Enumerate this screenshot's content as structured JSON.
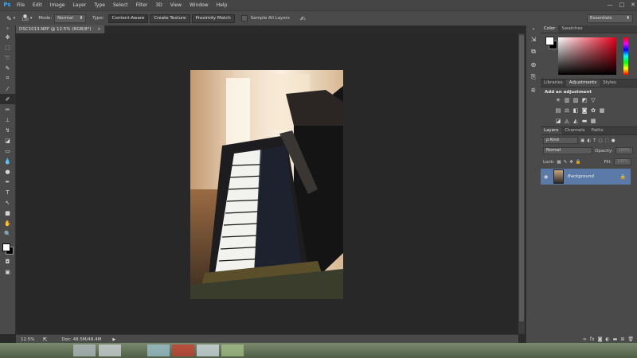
{
  "app": {
    "logo": "Ps"
  },
  "menu": [
    "File",
    "Edit",
    "Image",
    "Layer",
    "Type",
    "Select",
    "Filter",
    "3D",
    "View",
    "Window",
    "Help"
  ],
  "window_controls": {
    "minimize": "—",
    "maximize": "□",
    "close": "✕"
  },
  "options_bar": {
    "brush_size": "120",
    "mode_label": "Mode:",
    "mode_value": "Normal",
    "type_label": "Type:",
    "type_buttons": [
      "Content-Aware",
      "Create Texture",
      "Proximity Match"
    ],
    "sample_all_layers": "Sample All Layers",
    "workspace": "Essentials"
  },
  "document": {
    "tab_title": "DSC1013.NEF @ 12.5% (RGB/8*)",
    "close": "×",
    "zoom": "12.5%",
    "doc_size": "Doc: 48.5M/48.4M"
  },
  "panels": {
    "color_tabs": [
      "Color",
      "Swatches"
    ],
    "adj_tabs": [
      "Libraries",
      "Adjustments",
      "Styles"
    ],
    "adj_title": "Add an adjustment",
    "layers_tabs": [
      "Layers",
      "Channels",
      "Paths"
    ],
    "kind_label": "ρ Kind",
    "blend_mode": "Normal",
    "opacity_label": "Opacity:",
    "opacity_value": "100%",
    "lock_label": "Lock:",
    "fill_label": "Fill:",
    "fill_value": "100%",
    "layer_name": "Background"
  },
  "colors": {
    "foreground": "#ffffff",
    "background": "#000000",
    "accent": "#5b7aa8"
  }
}
